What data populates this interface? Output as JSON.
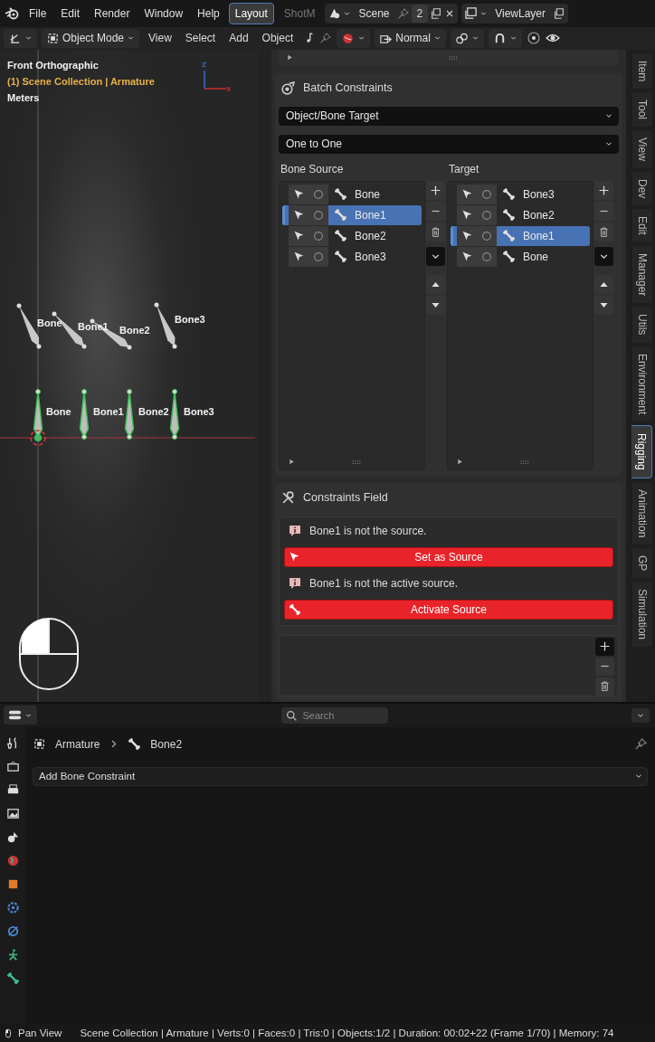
{
  "top_bar": {
    "menus": [
      "File",
      "Edit",
      "Render",
      "Window",
      "Help"
    ],
    "workspaces": [
      {
        "label": "Layout",
        "selected": true
      },
      {
        "label": "ShotM",
        "selected": false
      }
    ],
    "scene": "Scene",
    "scene_users": "2",
    "view_layer": "ViewLayer"
  },
  "viewport_header": {
    "mode": "Object Mode",
    "menus": [
      "View",
      "Select",
      "Add",
      "Object"
    ],
    "orientation": "Normal"
  },
  "viewport": {
    "view_name": "Front Orthographic",
    "collection": "(1) Scene Collection | Armature",
    "units": "Meters",
    "axes": [
      "Z",
      "X"
    ],
    "bones": [
      {
        "label": "Bone",
        "kind": "posed"
      },
      {
        "label": "Bone1",
        "kind": "posed"
      },
      {
        "label": "Bone2",
        "kind": "posed"
      },
      {
        "label": "Bone3",
        "kind": "posed"
      },
      {
        "label": "Bone",
        "kind": "rest"
      },
      {
        "label": "Bone1",
        "kind": "rest"
      },
      {
        "label": "Bone2",
        "kind": "rest"
      },
      {
        "label": "Bone3",
        "kind": "rest"
      }
    ]
  },
  "sidebar": {
    "batch": {
      "title": "Batch Constraints",
      "dropdowns": [
        "Object/Bone Target",
        "One to One"
      ],
      "source": {
        "label": "Bone Source",
        "items": [
          {
            "name": "Bone",
            "selected": false
          },
          {
            "name": "Bone1",
            "selected": true
          },
          {
            "name": "Bone2",
            "selected": false
          },
          {
            "name": "Bone3",
            "selected": false
          }
        ]
      },
      "target": {
        "label": "Target",
        "items": [
          {
            "name": "Bone3",
            "selected": false
          },
          {
            "name": "Bone2",
            "selected": false
          },
          {
            "name": "Bone1",
            "selected": true
          },
          {
            "name": "Bone",
            "selected": false
          }
        ]
      }
    },
    "constraints_field": {
      "title": "Constraints Field",
      "rows": [
        {
          "kind": "info",
          "text": "Bone1 is not the source."
        },
        {
          "kind": "select-button",
          "text": "Set as Source"
        },
        {
          "kind": "info",
          "text": "Bone1 is not the active source."
        },
        {
          "kind": "bone-button",
          "text": "Activate Source"
        }
      ]
    },
    "tabs": [
      {
        "label": "Item",
        "selected": false
      },
      {
        "label": "Tool",
        "selected": false
      },
      {
        "label": "View",
        "selected": false
      },
      {
        "label": "Dev",
        "selected": false
      },
      {
        "label": "Edit",
        "selected": false
      },
      {
        "label": "Manager",
        "selected": false
      },
      {
        "label": "Utils",
        "selected": false
      },
      {
        "label": "Environment",
        "selected": false
      },
      {
        "label": "Rigging",
        "selected": true
      },
      {
        "label": "Animation",
        "selected": false
      },
      {
        "label": "GP",
        "selected": false
      },
      {
        "label": "Simulation",
        "selected": false
      }
    ]
  },
  "properties": {
    "search": {
      "placeholder": "Search"
    },
    "breadcrumb": [
      "Armature",
      "Bone2"
    ],
    "add_constraint": "Add Bone Constraint"
  },
  "status_bar": {
    "action": "Pan View",
    "info": "Scene Collection | Armature | Verts:0 | Faces:0 | Tris:0 | Objects:1/2 | Duration: 00:02+22 (Frame 1/70) | Memory: 74"
  }
}
